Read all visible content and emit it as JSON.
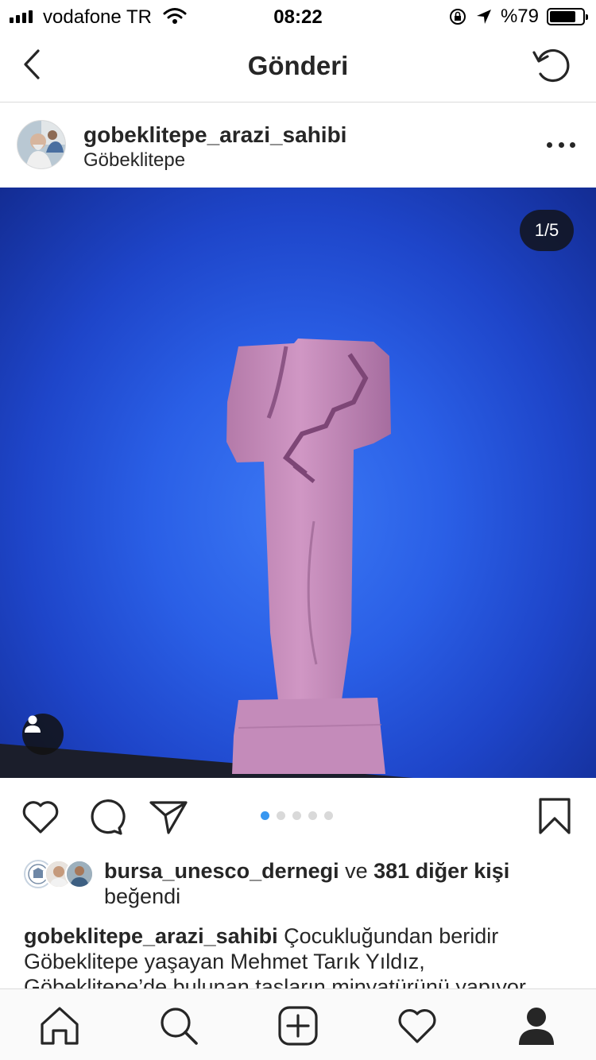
{
  "status_bar": {
    "carrier": "vodafone TR",
    "time": "08:22",
    "battery_percent": "%79",
    "battery_level": 0.79,
    "icons": [
      "signal-icon",
      "wifi-icon",
      "orientation-lock-icon",
      "location-arrow-icon",
      "battery-icon"
    ]
  },
  "nav": {
    "title": "Gönderi",
    "back_icon": "chevron-left-icon",
    "refresh_icon": "refresh-icon"
  },
  "post": {
    "username": "gobeklitepe_arazi_sahibi",
    "location": "Göbeklitepe",
    "page_indicator": "1/5",
    "current_slide": 1,
    "total_slides": 5
  },
  "actions": {
    "icons": [
      "heart-icon",
      "comment-icon",
      "share-icon",
      "bookmark-icon"
    ]
  },
  "likes": {
    "liker": "bursa_unesco_dernegi",
    "connector": " ve ",
    "others": "381 diğer kişi",
    "suffix": "beğendi"
  },
  "caption": {
    "username": "gobeklitepe_arazi_sahibi",
    "text": " Çocukluğundan beridir Göbeklitepe  yaşayan Mehmet Tarık Yıldız, Göbeklitepe’de bulunan taşların minyatürünü yapıyor"
  },
  "colors": {
    "sky": "#2a5fe6",
    "pillar": "#c38bb8",
    "active_dot": "#3897f0",
    "text": "#262626"
  },
  "tab_bar": {
    "icons": [
      "home-icon",
      "search-icon",
      "new-post-icon",
      "activity-heart-icon",
      "profile-icon"
    ]
  }
}
